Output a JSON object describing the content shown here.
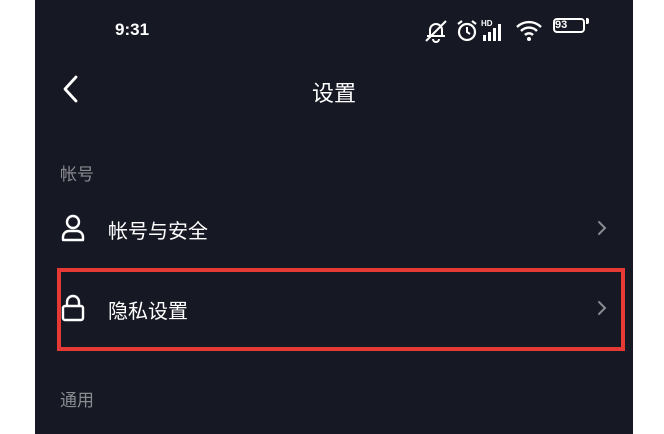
{
  "status_bar": {
    "time": "9:31",
    "battery_level": "93",
    "icons": [
      "notifications-off-icon",
      "alarm-icon",
      "hd-signal-icon",
      "wifi-icon",
      "battery-icon"
    ]
  },
  "nav": {
    "title": "设置",
    "back_icon": "chevron-left-icon"
  },
  "sections": {
    "account": {
      "label": "帐号",
      "items": [
        {
          "label": "帐号与安全",
          "icon": "user-icon"
        },
        {
          "label": "隐私设置",
          "icon": "lock-icon",
          "highlighted": true
        }
      ]
    },
    "general": {
      "label": "通用"
    }
  },
  "colors": {
    "background": "#161823",
    "text": "#ffffff",
    "muted": "#8a8b91",
    "highlight": "#e53935"
  }
}
